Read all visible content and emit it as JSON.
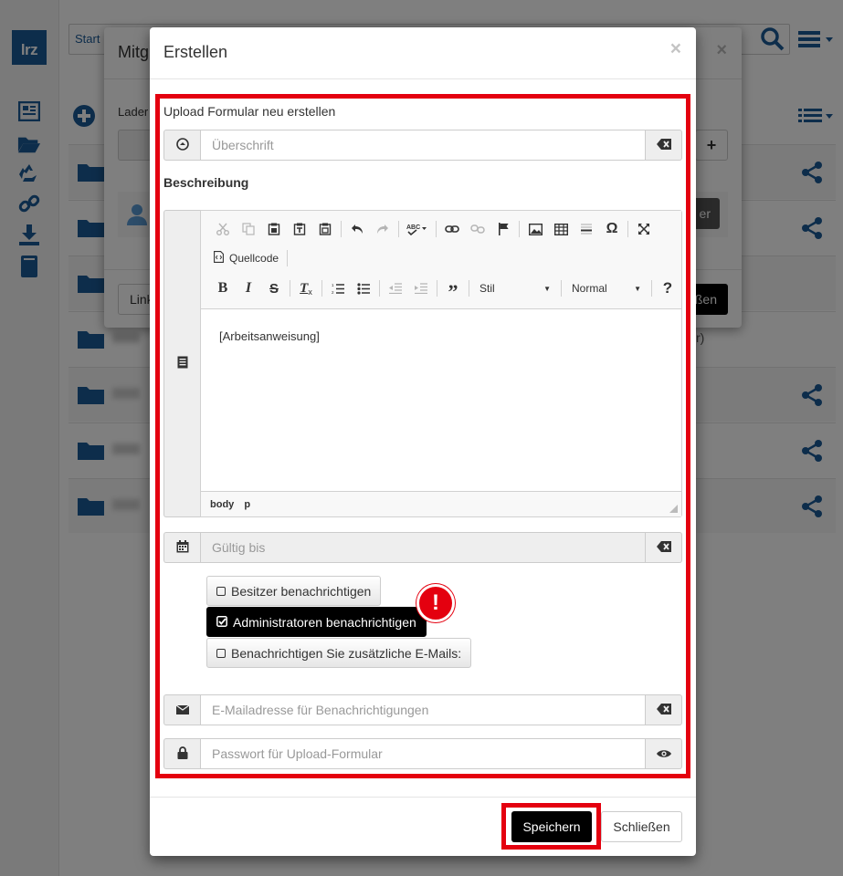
{
  "background": {
    "logo": "lrz",
    "search_placeholder": "Start",
    "sidebar_icons": [
      "newspaper-icon",
      "folder-open-icon",
      "recycle-icon",
      "link-icon",
      "download-icon",
      "book-icon"
    ],
    "row_count": 7,
    "back_modal": {
      "title": "Mitg",
      "lade_label": "Lader",
      "ger_button": "er",
      "link_button": "Link",
      "close_button": "ßen"
    },
    "right_text": "r)"
  },
  "modal": {
    "title": "Erstellen",
    "close_symbol": "×",
    "upload_title": "Upload Formular neu erstellen",
    "heading_placeholder": "Überschrift",
    "description_label": "Beschreibung",
    "editor": {
      "source_label": "Quellcode",
      "style_combo": "Stil",
      "format_combo": "Normal",
      "content": "[Arbeitsanweisung]",
      "status_path": [
        "body",
        "p"
      ]
    },
    "valid_until_placeholder": "Gültig bis",
    "notify": {
      "owner_label": "Besitzer benachrichtigen",
      "admins_label": "Administratoren benachrichtigen",
      "extra_label": "Benachrichtigen Sie zusätzliche E-Mails:",
      "admins_checked": true
    },
    "warning_badge": "!",
    "email_placeholder": "E-Mailadresse für Benachrichtigungen",
    "password_placeholder": "Passwort für Upload-Formular",
    "save_button": "Speichern",
    "close_button": "Schließen"
  },
  "colors": {
    "highlight": "#e4000f",
    "brand": "#1b5a96",
    "primary_button": "#000000"
  }
}
